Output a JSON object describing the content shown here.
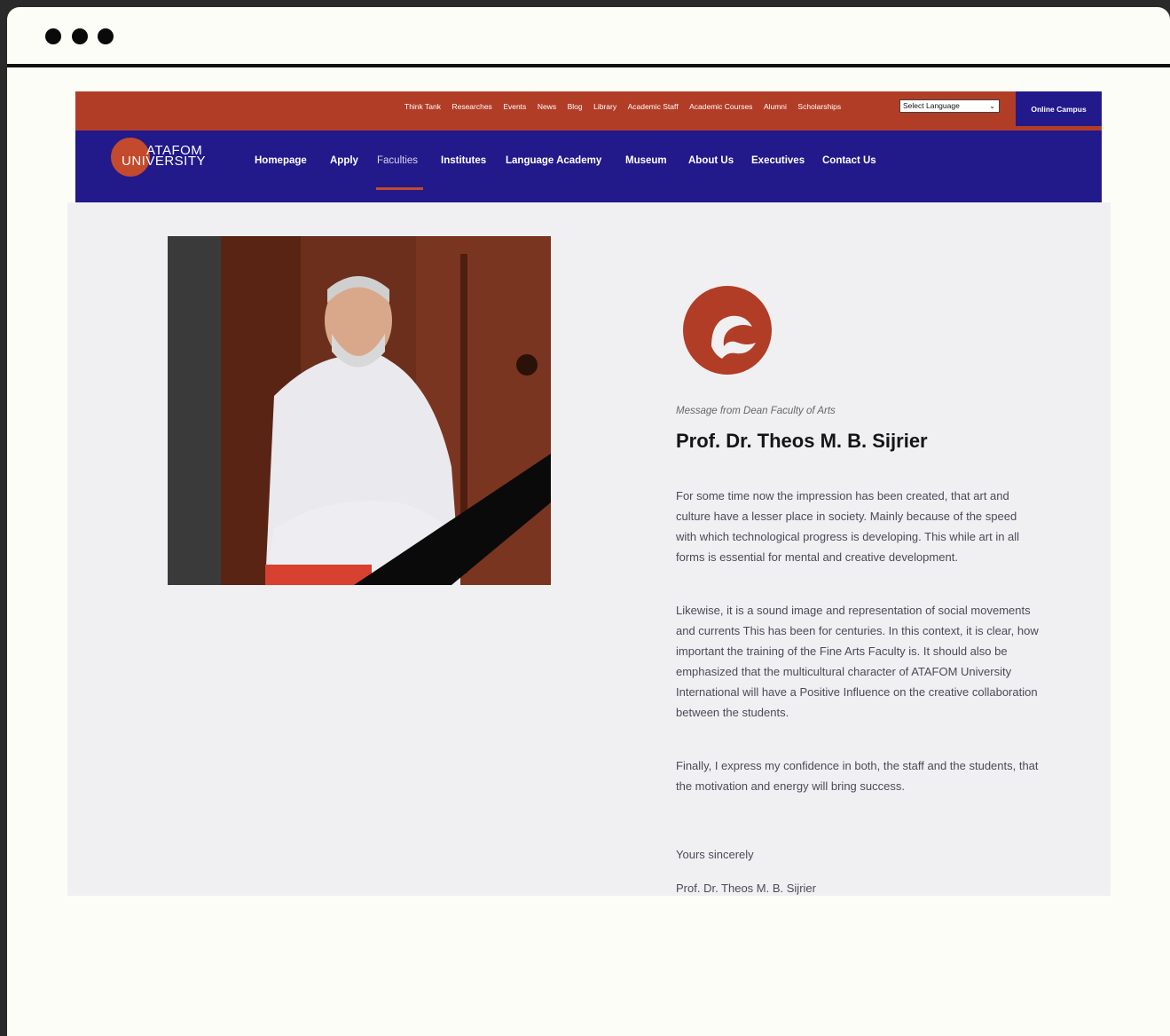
{
  "topbar": {
    "links": [
      "Think Tank",
      "Researches",
      "Events",
      "News",
      "Blog",
      "Library",
      "Academic Staff",
      "Academic Courses",
      "Alumni",
      "Scholarships"
    ],
    "language_select": "Select Language",
    "online_campus": "Online Campus"
  },
  "logo": {
    "line1": "ATAFOM",
    "line2": "UNIVERSITY"
  },
  "nav": {
    "items": [
      "Homepage",
      "Apply",
      "Faculties",
      "Institutes",
      "Language Academy",
      "Museum",
      "About Us",
      "Executives",
      "Contact Us"
    ],
    "active": "Faculties"
  },
  "message": {
    "subtitle": "Message from Dean Faculty of Arts",
    "name": "Prof. Dr. Theos M. B. Sijrier",
    "paragraphs": [
      "For some time now the impression has been created, that art and culture have a lesser place in society. Mainly because of the speed with which technological progress is developing. This while art in all forms is essential for mental and creative development.",
      "Likewise, it is a sound image and representation of social movements and currents This has been for centuries. In this context, it is clear, how important the training of the Fine Arts Faculty is. It should also be emphasized that the multicultural character of ATAFOM University International will have a Positive Influence on the creative collaboration between the students.",
      "Finally, I express my confidence in both, the staff and the students, that the motivation and energy will bring success."
    ],
    "closing": "Yours sincerely",
    "signature": "Prof. Dr. Theos M. B. Sijrier"
  },
  "colors": {
    "brand_red": "#b23d27",
    "brand_blue": "#22198a",
    "accent": "#c34a2c"
  }
}
